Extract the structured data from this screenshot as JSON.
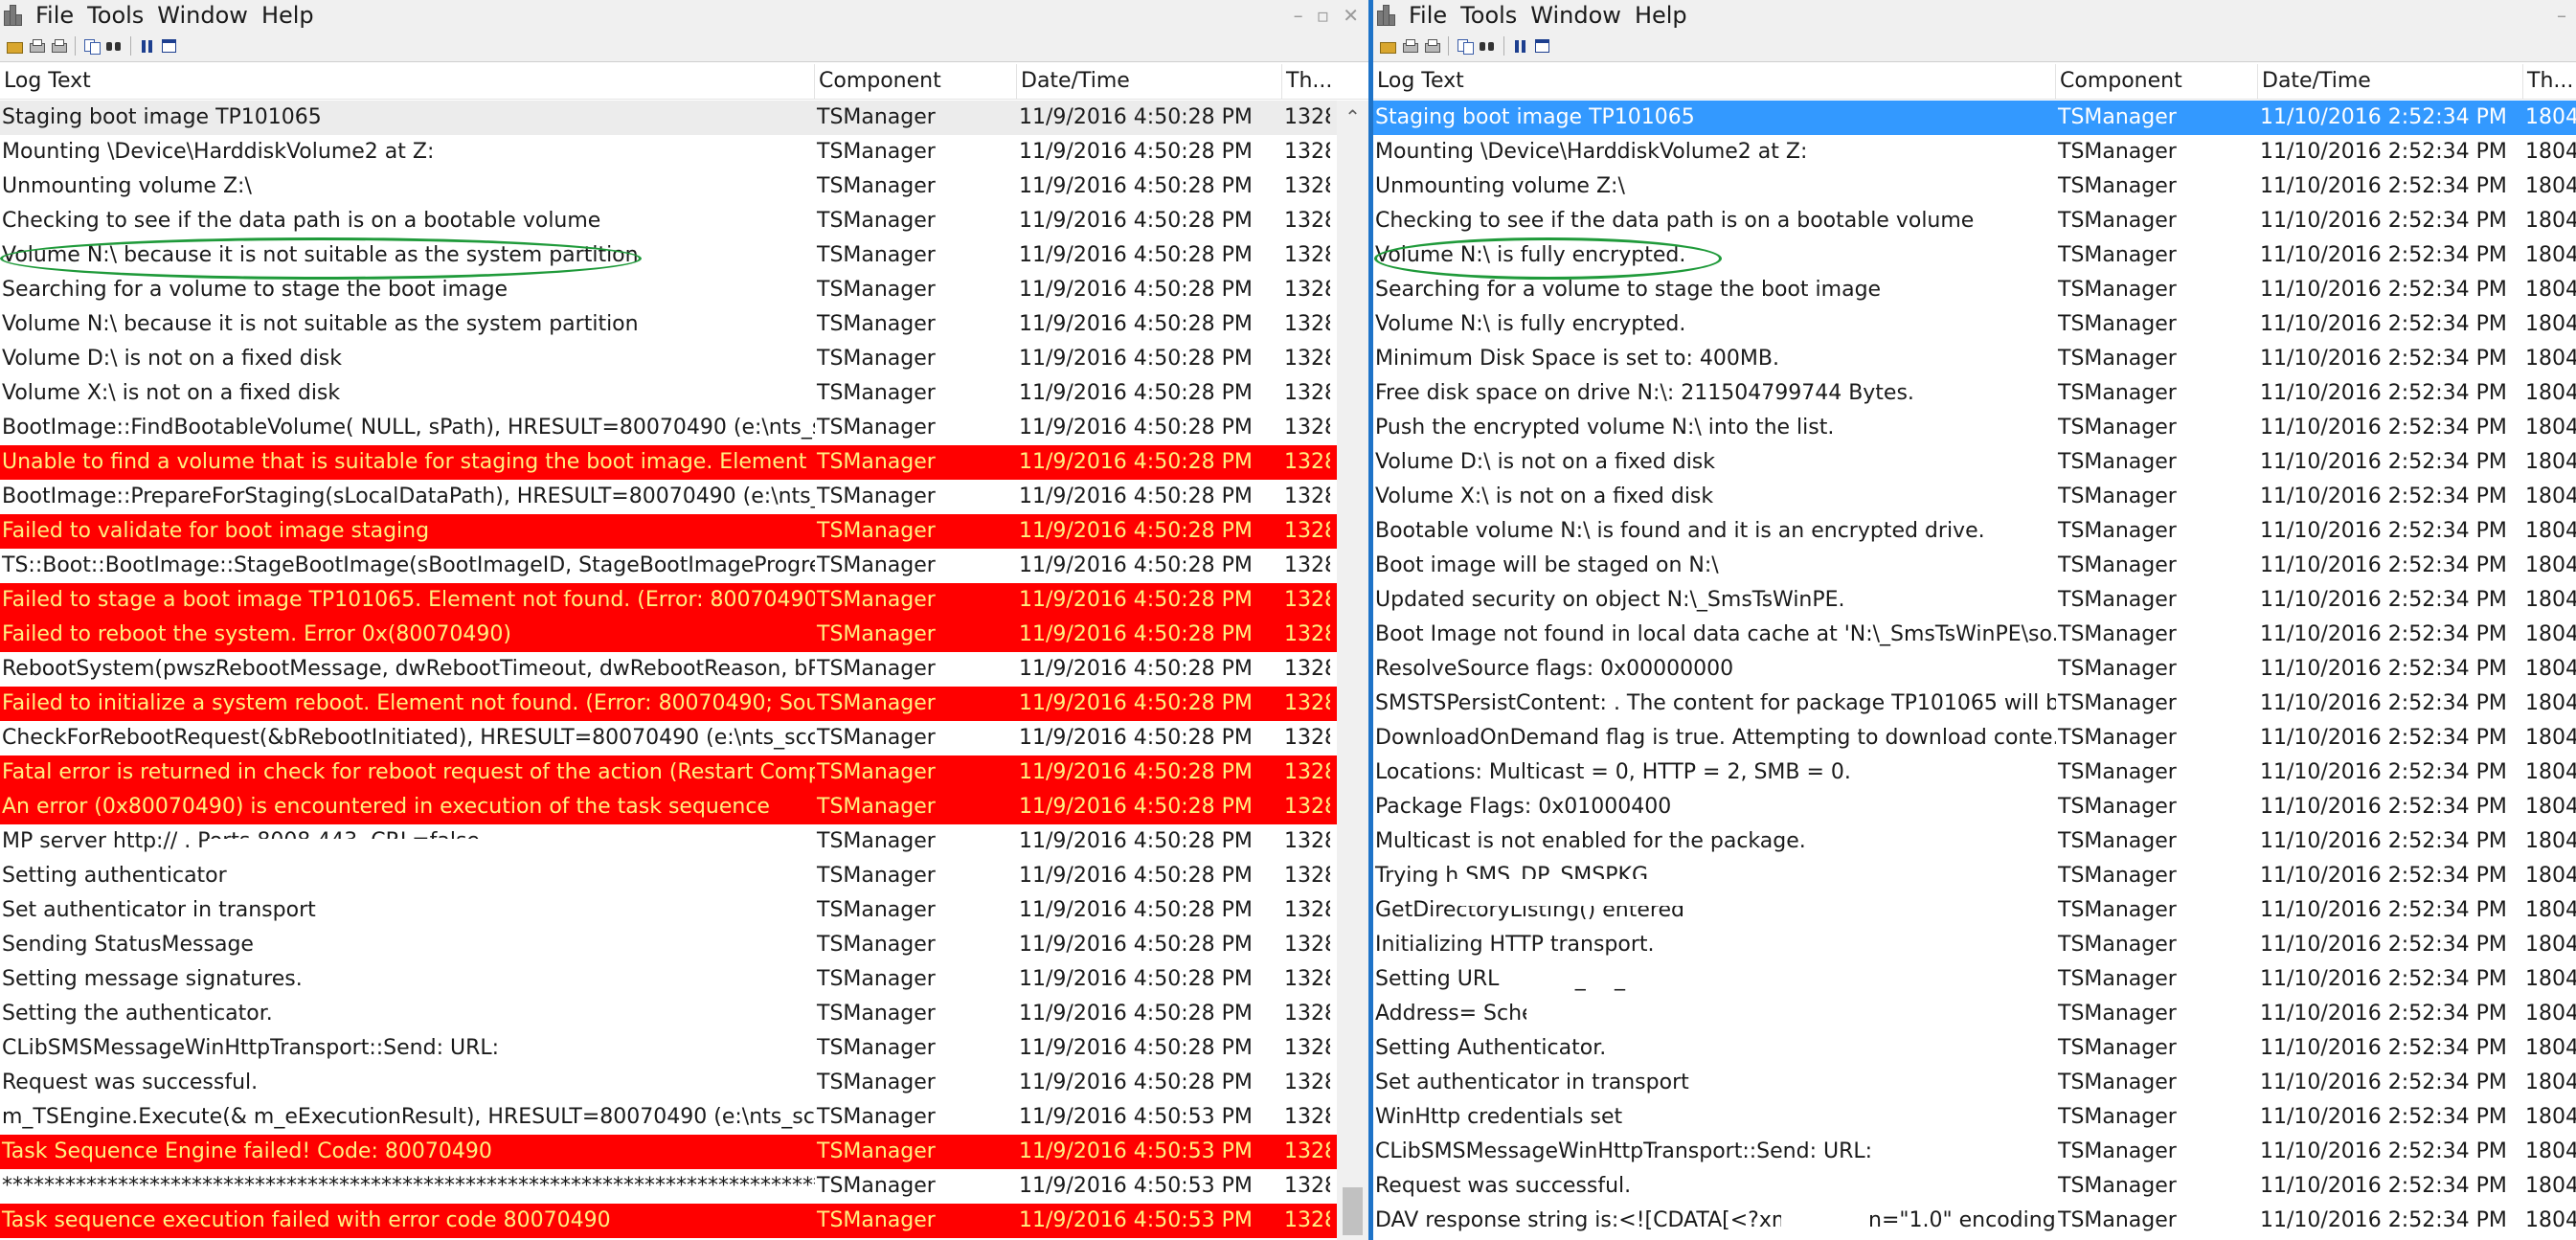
{
  "left": {
    "menu": [
      "File",
      "Tools",
      "Window",
      "Help"
    ],
    "columns": [
      "Log Text",
      "Component",
      "Date/Time",
      "Th..."
    ],
    "rows": [
      {
        "text": "Staging boot image TP101065",
        "component": "TSManager",
        "datetime": "11/9/2016 4:50:28 PM",
        "thread": "1328",
        "type": "normal"
      },
      {
        "text": "Mounting \\Device\\HarddiskVolume2 at Z:",
        "component": "TSManager",
        "datetime": "11/9/2016 4:50:28 PM",
        "thread": "1328",
        "type": "normal"
      },
      {
        "text": "Unmounting volume Z:\\",
        "component": "TSManager",
        "datetime": "11/9/2016 4:50:28 PM",
        "thread": "1328",
        "type": "normal"
      },
      {
        "text": "Checking to see if the data path is on a bootable volume",
        "component": "TSManager",
        "datetime": "11/9/2016 4:50:28 PM",
        "thread": "1328",
        "type": "normal"
      },
      {
        "text": "Volume N:\\ because it is not suitable as the system partition",
        "component": "TSManager",
        "datetime": "11/9/2016 4:50:28 PM",
        "thread": "1328",
        "type": "normal"
      },
      {
        "text": "Searching for a volume to stage the boot image",
        "component": "TSManager",
        "datetime": "11/9/2016 4:50:28 PM",
        "thread": "1328",
        "type": "normal"
      },
      {
        "text": "Volume N:\\ because it is not suitable as the system partition",
        "component": "TSManager",
        "datetime": "11/9/2016 4:50:28 PM",
        "thread": "1328",
        "type": "normal"
      },
      {
        "text": "Volume D:\\ is not on a fixed disk",
        "component": "TSManager",
        "datetime": "11/9/2016 4:50:28 PM",
        "thread": "1328",
        "type": "normal"
      },
      {
        "text": "Volume X:\\ is not on a fixed disk",
        "component": "TSManager",
        "datetime": "11/9/2016 4:50:28 PM",
        "thread": "1328",
        "type": "normal"
      },
      {
        "text": "BootImage::FindBootableVolume( NULL, sPath), HRESULT=80070490 (e:\\nts_sc...",
        "component": "TSManager",
        "datetime": "11/9/2016 4:50:28 PM",
        "thread": "1328",
        "type": "normal"
      },
      {
        "text": "Unable to find a volume that is suitable for staging the boot image. Element ...",
        "component": "TSManager",
        "datetime": "11/9/2016 4:50:28 PM",
        "thread": "1328",
        "type": "error"
      },
      {
        "text": "BootImage::PrepareForStaging(sLocalDataPath), HRESULT=80070490 (e:\\nts_scc...",
        "component": "TSManager",
        "datetime": "11/9/2016 4:50:28 PM",
        "thread": "1328",
        "type": "normal"
      },
      {
        "text": "Failed to validate for boot image staging",
        "component": "TSManager",
        "datetime": "11/9/2016 4:50:28 PM",
        "thread": "1328",
        "type": "error"
      },
      {
        "text": "TS::Boot::BootImage::StageBootImage(sBootImageID, StageBootImageProgress...",
        "component": "TSManager",
        "datetime": "11/9/2016 4:50:28 PM",
        "thread": "1328",
        "type": "normal"
      },
      {
        "text": "Failed to stage a boot image TP101065. Element not found. (Error: 80070490; ...",
        "component": "TSManager",
        "datetime": "11/9/2016 4:50:28 PM",
        "thread": "1328",
        "type": "error"
      },
      {
        "text": "Failed to reboot the system. Error 0x(80070490)",
        "component": "TSManager",
        "datetime": "11/9/2016 4:50:28 PM",
        "thread": "1328",
        "type": "error"
      },
      {
        "text": "RebootSystem(pwszRebootMessage, dwRebootTimeout, dwRebootReason, bR...",
        "component": "TSManager",
        "datetime": "11/9/2016 4:50:28 PM",
        "thread": "1328",
        "type": "normal"
      },
      {
        "text": "Failed to initialize a system reboot. Element not found. (Error: 80070490; Sour...",
        "component": "TSManager",
        "datetime": "11/9/2016 4:50:28 PM",
        "thread": "1328",
        "type": "error"
      },
      {
        "text": "CheckForRebootRequest(&bRebootInitiated), HRESULT=80070490 (e:\\nts_sccm...",
        "component": "TSManager",
        "datetime": "11/9/2016 4:50:28 PM",
        "thread": "1328",
        "type": "normal"
      },
      {
        "text": "Fatal error is returned in check for reboot request of the action (Restart Comp...",
        "component": "TSManager",
        "datetime": "11/9/2016 4:50:28 PM",
        "thread": "1328",
        "type": "error"
      },
      {
        "text": "An error (0x80070490) is encountered in execution of the task sequence",
        "component": "TSManager",
        "datetime": "11/9/2016 4:50:28 PM",
        "thread": "1328",
        "type": "error"
      },
      {
        "text": "MP server http://                                    . Ports 8008,443. CRL=false.",
        "component": "TSManager",
        "datetime": "11/9/2016 4:50:28 PM",
        "thread": "1328",
        "type": "normal"
      },
      {
        "text": "Setting authenticator",
        "component": "TSManager",
        "datetime": "11/9/2016 4:50:28 PM",
        "thread": "1328",
        "type": "normal"
      },
      {
        "text": "Set authenticator in transport",
        "component": "TSManager",
        "datetime": "11/9/2016 4:50:28 PM",
        "thread": "1328",
        "type": "normal"
      },
      {
        "text": "Sending StatusMessage",
        "component": "TSManager",
        "datetime": "11/9/2016 4:50:28 PM",
        "thread": "1328",
        "type": "normal"
      },
      {
        "text": "Setting message signatures.",
        "component": "TSManager",
        "datetime": "11/9/2016 4:50:28 PM",
        "thread": "1328",
        "type": "normal"
      },
      {
        "text": "Setting the authenticator.",
        "component": "TSManager",
        "datetime": "11/9/2016 4:50:28 PM",
        "thread": "1328",
        "type": "normal"
      },
      {
        "text": "CLibSMSMessageWinHttpTransport::Send: URL:",
        "component": "TSManager",
        "datetime": "11/9/2016 4:50:28 PM",
        "thread": "1328",
        "type": "normal"
      },
      {
        "text": "Request was successful.",
        "component": "TSManager",
        "datetime": "11/9/2016 4:50:28 PM",
        "thread": "1328",
        "type": "normal"
      },
      {
        "text": "m_TSEngine.Execute(& m_eExecutionResult), HRESULT=80070490 (e:\\nts_sccm...",
        "component": "TSManager",
        "datetime": "11/9/2016 4:50:53 PM",
        "thread": "1328",
        "type": "normal"
      },
      {
        "text": "Task Sequence Engine failed! Code: 80070490",
        "component": "TSManager",
        "datetime": "11/9/2016 4:50:53 PM",
        "thread": "1328",
        "type": "error"
      },
      {
        "text": "*******************************************************************************",
        "component": "TSManager",
        "datetime": "11/9/2016 4:50:53 PM",
        "thread": "1328",
        "type": "normal"
      },
      {
        "text": "Task sequence execution failed with error code 80070490",
        "component": "TSManager",
        "datetime": "11/9/2016 4:50:53 PM",
        "thread": "1328",
        "type": "error"
      }
    ]
  },
  "right": {
    "menu": [
      "File",
      "Tools",
      "Window",
      "Help"
    ],
    "columns": [
      "Log Text",
      "Component",
      "Date/Time",
      "Th..."
    ],
    "rows": [
      {
        "text": "Staging boot image TP101065",
        "component": "TSManager",
        "datetime": "11/10/2016 2:52:34 PM",
        "thread": "1804",
        "type": "selected"
      },
      {
        "text": "Mounting \\Device\\HarddiskVolume2 at Z:",
        "component": "TSManager",
        "datetime": "11/10/2016 2:52:34 PM",
        "thread": "1804",
        "type": "normal"
      },
      {
        "text": "Unmounting volume Z:\\",
        "component": "TSManager",
        "datetime": "11/10/2016 2:52:34 PM",
        "thread": "1804",
        "type": "normal"
      },
      {
        "text": "Checking to see if the data path is on a bootable volume",
        "component": "TSManager",
        "datetime": "11/10/2016 2:52:34 PM",
        "thread": "1804",
        "type": "normal"
      },
      {
        "text": "Volume N:\\ is fully encrypted.",
        "component": "TSManager",
        "datetime": "11/10/2016 2:52:34 PM",
        "thread": "1804",
        "type": "normal"
      },
      {
        "text": "Searching for a volume to stage the boot image",
        "component": "TSManager",
        "datetime": "11/10/2016 2:52:34 PM",
        "thread": "1804",
        "type": "normal"
      },
      {
        "text": "Volume N:\\ is fully encrypted.",
        "component": "TSManager",
        "datetime": "11/10/2016 2:52:34 PM",
        "thread": "1804",
        "type": "normal"
      },
      {
        "text": "Minimum Disk Space is set to: 400MB.",
        "component": "TSManager",
        "datetime": "11/10/2016 2:52:34 PM",
        "thread": "1804",
        "type": "normal"
      },
      {
        "text": "Free disk space on drive N:\\: 211504799744 Bytes.",
        "component": "TSManager",
        "datetime": "11/10/2016 2:52:34 PM",
        "thread": "1804",
        "type": "normal"
      },
      {
        "text": "Push the encrypted volume N:\\ into the list.",
        "component": "TSManager",
        "datetime": "11/10/2016 2:52:34 PM",
        "thread": "1804",
        "type": "normal"
      },
      {
        "text": "Volume D:\\ is not on a fixed disk",
        "component": "TSManager",
        "datetime": "11/10/2016 2:52:34 PM",
        "thread": "1804",
        "type": "normal"
      },
      {
        "text": "Volume X:\\ is not on a fixed disk",
        "component": "TSManager",
        "datetime": "11/10/2016 2:52:34 PM",
        "thread": "1804",
        "type": "normal"
      },
      {
        "text": "Bootable volume N:\\ is found and it is an encrypted drive.",
        "component": "TSManager",
        "datetime": "11/10/2016 2:52:34 PM",
        "thread": "1804",
        "type": "normal"
      },
      {
        "text": "Boot image will be staged on N:\\",
        "component": "TSManager",
        "datetime": "11/10/2016 2:52:34 PM",
        "thread": "1804",
        "type": "normal"
      },
      {
        "text": "Updated security on object N:\\_SmsTsWinPE.",
        "component": "TSManager",
        "datetime": "11/10/2016 2:52:34 PM",
        "thread": "1804",
        "type": "normal"
      },
      {
        "text": "Boot Image not found in local data cache at 'N:\\_SmsTsWinPE\\so...",
        "component": "TSManager",
        "datetime": "11/10/2016 2:52:34 PM",
        "thread": "1804",
        "type": "normal"
      },
      {
        "text": "ResolveSource flags: 0x00000000",
        "component": "TSManager",
        "datetime": "11/10/2016 2:52:34 PM",
        "thread": "1804",
        "type": "normal"
      },
      {
        "text": "SMSTSPersistContent: . The content for package TP101065 will b...",
        "component": "TSManager",
        "datetime": "11/10/2016 2:52:34 PM",
        "thread": "1804",
        "type": "normal"
      },
      {
        "text": "DownloadOnDemand flag is true. Attempting to download conte...",
        "component": "TSManager",
        "datetime": "11/10/2016 2:52:34 PM",
        "thread": "1804",
        "type": "normal"
      },
      {
        "text": "Locations: Multicast = 0, HTTP = 2, SMB = 0.",
        "component": "TSManager",
        "datetime": "11/10/2016 2:52:34 PM",
        "thread": "1804",
        "type": "normal"
      },
      {
        "text": "Package Flags: 0x01000400",
        "component": "TSManager",
        "datetime": "11/10/2016 2:52:34 PM",
        "thread": "1804",
        "type": "normal"
      },
      {
        "text": "Multicast is not enabled for the package.",
        "component": "TSManager",
        "datetime": "11/10/2016 2:52:34 PM",
        "thread": "1804",
        "type": "normal"
      },
      {
        "text": "Trying h                                              SMS_DP_SMSPKG...",
        "component": "TSManager",
        "datetime": "11/10/2016 2:52:34 PM",
        "thread": "1804",
        "type": "normal"
      },
      {
        "text": "GetDirectoryListing() entered",
        "component": "TSManager",
        "datetime": "11/10/2016 2:52:34 PM",
        "thread": "1804",
        "type": "normal"
      },
      {
        "text": "Initializing HTTP transport.",
        "component": "TSManager",
        "datetime": "11/10/2016 2:52:34 PM",
        "thread": "1804",
        "type": "normal"
      },
      {
        "text": "Setting URL =                                                   SMS_DP_...",
        "component": "TSManager",
        "datetime": "11/10/2016 2:52:34 PM",
        "thread": "1804",
        "type": "normal"
      },
      {
        "text": "    Address=                                                  Scheme=htt...",
        "component": "TSManager",
        "datetime": "11/10/2016 2:52:34 PM",
        "thread": "1804",
        "type": "normal"
      },
      {
        "text": "Setting Authenticator.",
        "component": "TSManager",
        "datetime": "11/10/2016 2:52:34 PM",
        "thread": "1804",
        "type": "normal"
      },
      {
        "text": "Set authenticator in transport",
        "component": "TSManager",
        "datetime": "11/10/2016 2:52:34 PM",
        "thread": "1804",
        "type": "normal"
      },
      {
        "text": "WinHttp credentials set",
        "component": "TSManager",
        "datetime": "11/10/2016 2:52:34 PM",
        "thread": "1804",
        "type": "normal"
      },
      {
        "text": "CLibSMSMessageWinHttpTransport::Send: URL:",
        "component": "TSManager",
        "datetime": "11/10/2016 2:52:34 PM",
        "thread": "1804",
        "type": "normal"
      },
      {
        "text": "Request was successful.",
        "component": "TSManager",
        "datetime": "11/10/2016 2:52:34 PM",
        "thread": "1804",
        "type": "normal"
      },
      {
        "text": "DAV response string is:<![CDATA[<?xml version=\"1.0\" encoding=...",
        "component": "TSManager",
        "datetime": "11/10/2016 2:52:34 PM",
        "thread": "1804",
        "type": "normal"
      }
    ]
  },
  "colors": {
    "error_bg": "#ff0000",
    "error_text": "#fff080",
    "selected_bg": "#3399ff",
    "annotation": "#1f9a3a",
    "divider": "#1e73c8"
  }
}
